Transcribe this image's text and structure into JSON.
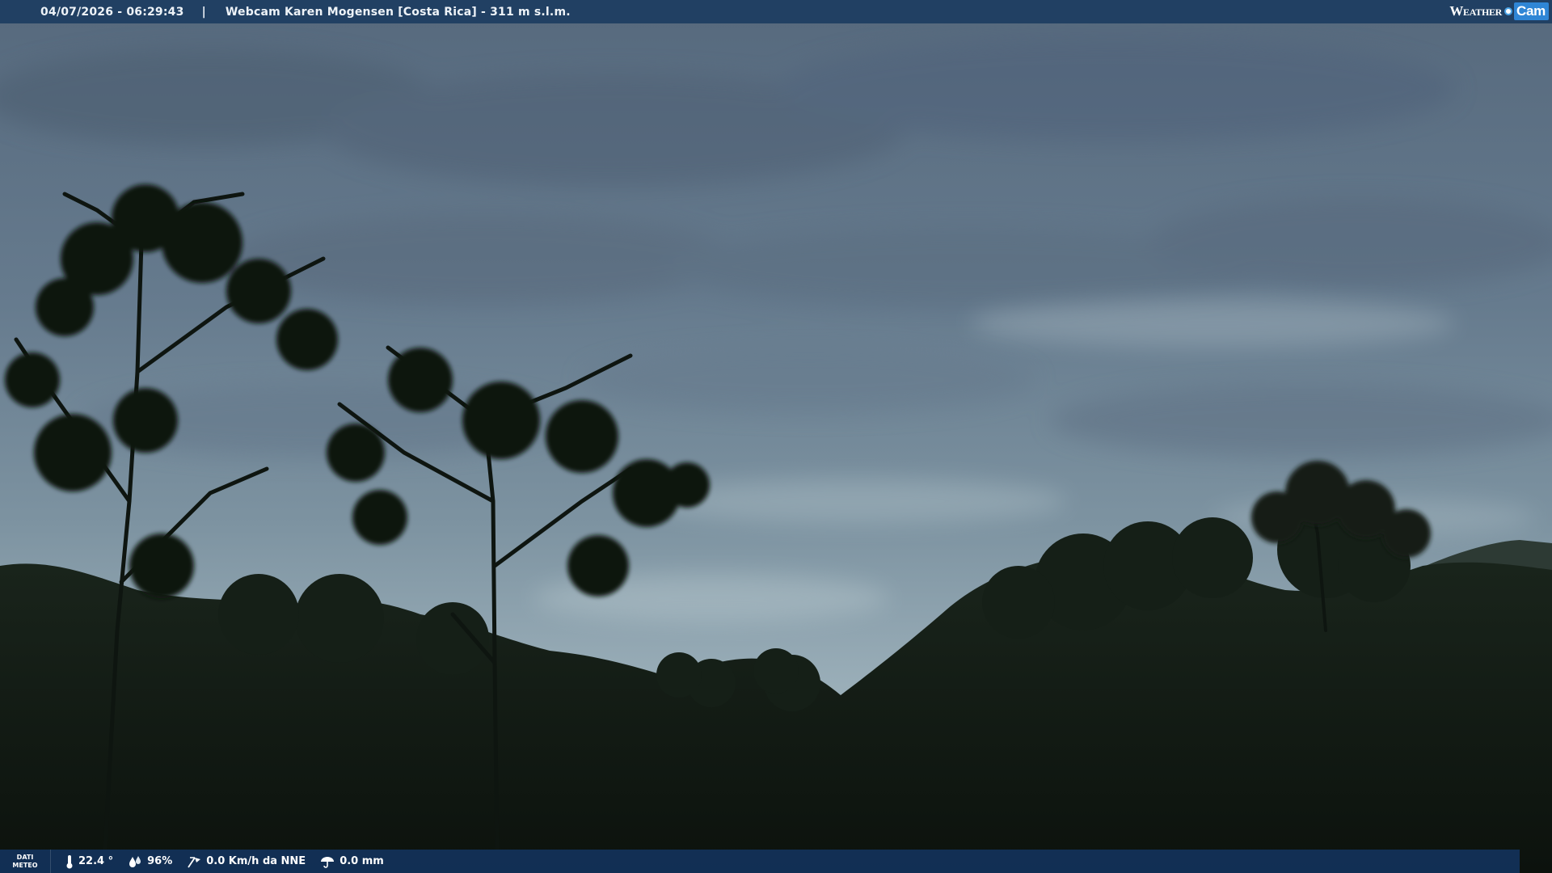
{
  "header": {
    "datetime": "04/07/2026 - 06:29:43",
    "separator": "|",
    "camera_title": "Webcam Karen Mogensen [Costa Rica]  - 311 m s.l.m.",
    "brand_weather": "Weather",
    "brand_cam": "Cam"
  },
  "footer": {
    "meteo_label_line1": "DATI",
    "meteo_label_line2": "METEO",
    "temperature": "22.4 °",
    "humidity": "96%",
    "wind": "0.0 Km/h da NNE",
    "rain": "0.0 mm"
  },
  "icons": {
    "temperature": "thermometer-icon",
    "humidity": "humidity-drop-icon",
    "wind": "wind-icon",
    "rain": "rain-umbrella-icon"
  },
  "colors": {
    "top_bar": "#1a3a60",
    "bottom_bar": "#12325a",
    "sky_top": "#5f7387",
    "sky_horizon": "#9fb3bd",
    "foliage": "#121a14"
  }
}
